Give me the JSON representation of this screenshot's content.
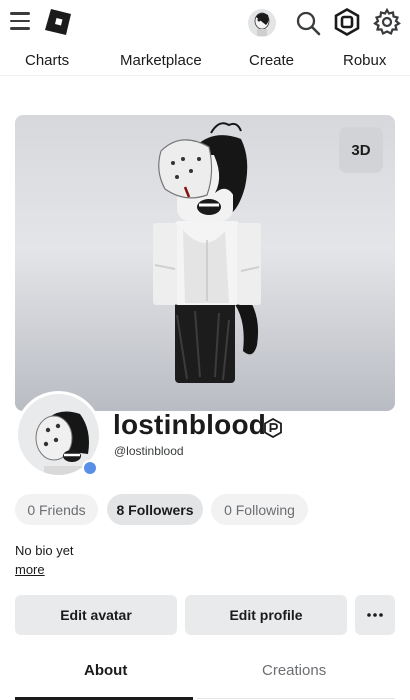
{
  "header": {
    "menu_icon": "hamburger-menu-icon",
    "logo_icon": "roblox-logo-icon",
    "search_icon": "search-icon",
    "robux_icon": "robux-icon",
    "settings_icon": "gear-icon"
  },
  "nav": {
    "items": [
      {
        "label": "Charts"
      },
      {
        "label": "Marketplace"
      },
      {
        "label": "Create"
      },
      {
        "label": "Robux"
      }
    ]
  },
  "avatar_view": {
    "toggle_label": "3D"
  },
  "profile": {
    "display_name": "lostinblood",
    "username": "@lostinblood",
    "premium_icon": "premium-badge-icon",
    "status_color": "#5a8fe8"
  },
  "stats": [
    {
      "label": "0 Friends",
      "active": false
    },
    {
      "label": "8 Followers",
      "active": true
    },
    {
      "label": "0 Following",
      "active": false
    }
  ],
  "bio": {
    "text": "No bio yet",
    "more_label": "more"
  },
  "actions": {
    "edit_avatar": "Edit avatar",
    "edit_profile": "Edit profile",
    "more_icon": "ellipsis-icon"
  },
  "tabs": [
    {
      "label": "About",
      "active": true
    },
    {
      "label": "Creations",
      "active": false
    }
  ]
}
